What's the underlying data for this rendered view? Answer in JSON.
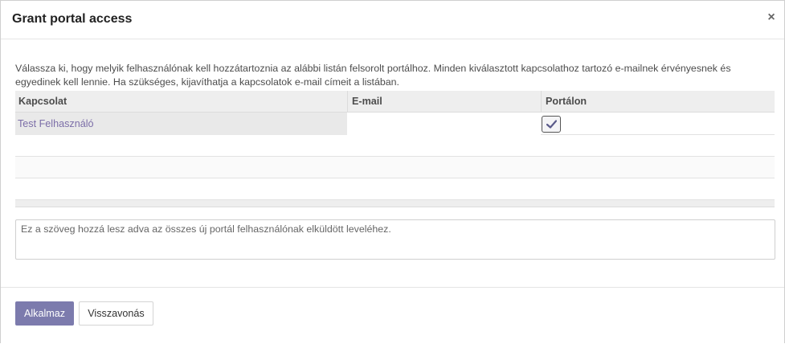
{
  "dialog": {
    "title": "Grant portal access",
    "close_glyph": "×",
    "intro_text": "Válassza ki, hogy melyik felhasználónak kell hozzátartoznia az alábbi listán felsorolt portálhoz. Minden kiválasztott kapcsolathoz tartozó e-mailnek érvényesnek és egyedinek kell lennie. Ha szükséges, kijavíthatja a kapcsolatok e-mail címeit a listában."
  },
  "table": {
    "columns": [
      "Kapcsolat",
      "E-mail",
      "Portálon"
    ],
    "rows": [
      {
        "contact": "Test Felhasználó",
        "email": "",
        "in_portal": true,
        "checkbox_icon": "check-icon"
      }
    ]
  },
  "welcome_message": {
    "placeholder": "Ez a szöveg hozzá lesz adva az összes új portál felhasználónak elküldött leveléhez.",
    "value": ""
  },
  "footer": {
    "apply_label": "Alkalmaz",
    "cancel_label": "Visszavonás"
  },
  "colors": {
    "primary": "#7c7bad",
    "link": "#7c6ea8"
  }
}
